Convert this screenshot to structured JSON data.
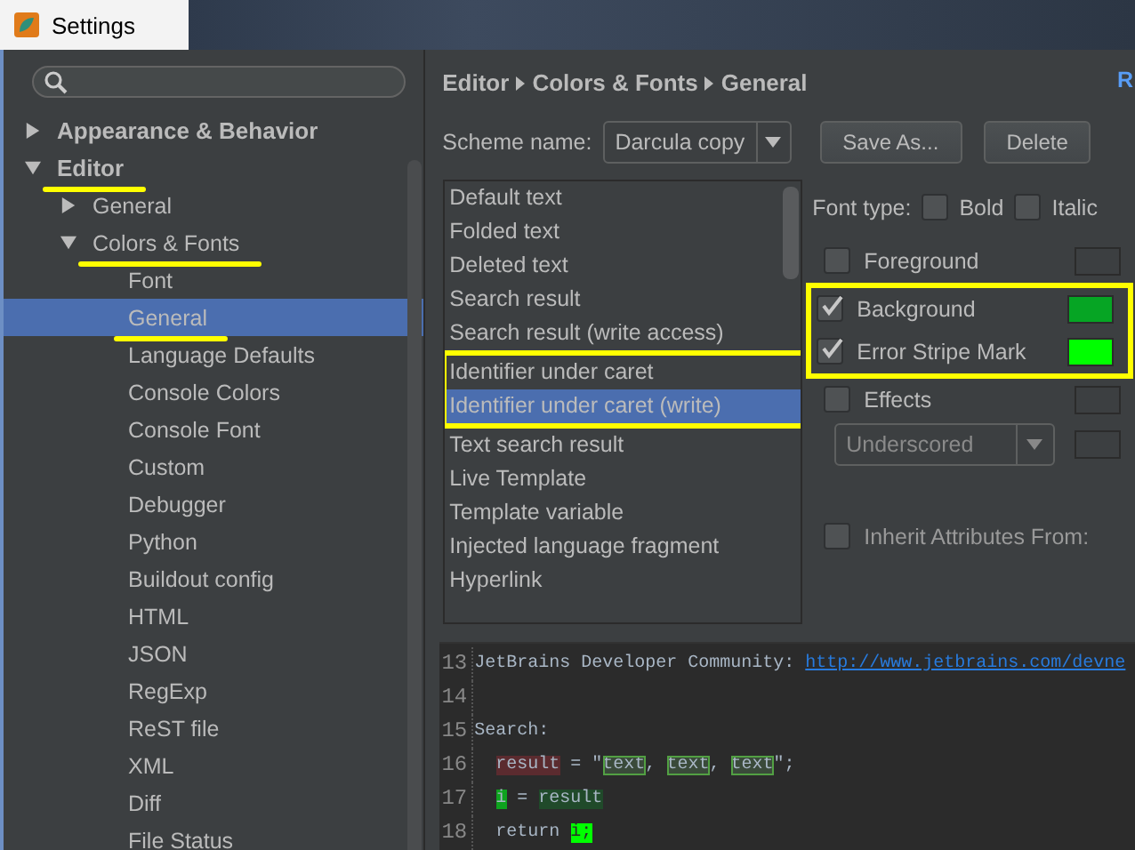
{
  "window": {
    "title": "Settings"
  },
  "sidebar": {
    "tree": [
      {
        "label": "Appearance & Behavior",
        "bold": true,
        "expanded": false,
        "underlined": false,
        "selected": false
      },
      {
        "label": "Editor",
        "bold": true,
        "expanded": true,
        "underlined": true,
        "selected": false,
        "children": [
          {
            "label": "General",
            "expanded": false,
            "underlined": false,
            "selected": false
          },
          {
            "label": "Colors & Fonts",
            "expanded": true,
            "underlined": true,
            "selected": false,
            "children": [
              {
                "label": "Font",
                "underlined": false,
                "selected": false
              },
              {
                "label": "General",
                "underlined": true,
                "selected": true
              },
              {
                "label": "Language Defaults",
                "underlined": false,
                "selected": false
              },
              {
                "label": "Console Colors",
                "underlined": false,
                "selected": false
              },
              {
                "label": "Console Font",
                "underlined": false,
                "selected": false
              },
              {
                "label": "Custom",
                "underlined": false,
                "selected": false
              },
              {
                "label": "Debugger",
                "underlined": false,
                "selected": false
              },
              {
                "label": "Python",
                "underlined": false,
                "selected": false
              },
              {
                "label": "Buildout config",
                "underlined": false,
                "selected": false
              },
              {
                "label": "HTML",
                "underlined": false,
                "selected": false
              },
              {
                "label": "JSON",
                "underlined": false,
                "selected": false
              },
              {
                "label": "RegExp",
                "underlined": false,
                "selected": false
              },
              {
                "label": "ReST file",
                "underlined": false,
                "selected": false
              },
              {
                "label": "XML",
                "underlined": false,
                "selected": false
              },
              {
                "label": "Diff",
                "underlined": false,
                "selected": false
              },
              {
                "label": "File Status",
                "underlined": false,
                "selected": false
              }
            ]
          }
        ]
      }
    ]
  },
  "breadcrumb": [
    "Editor",
    "Colors & Fonts",
    "General"
  ],
  "reset_link": "R",
  "scheme": {
    "label": "Scheme name:",
    "value": "Darcula copy",
    "buttons": [
      "Save As...",
      "Delete"
    ]
  },
  "attributes": [
    {
      "label": "Default text",
      "selected": false,
      "boxed": false
    },
    {
      "label": "Folded text",
      "selected": false,
      "boxed": false
    },
    {
      "label": "Deleted text",
      "selected": false,
      "boxed": false
    },
    {
      "label": "Search result",
      "selected": false,
      "boxed": false
    },
    {
      "label": "Search result (write access)",
      "selected": false,
      "boxed": false
    },
    {
      "label": "Identifier under caret",
      "selected": false,
      "boxed": true
    },
    {
      "label": "Identifier under caret (write)",
      "selected": true,
      "boxed": true
    },
    {
      "label": "Text search result",
      "selected": false,
      "boxed": false
    },
    {
      "label": "Live Template",
      "selected": false,
      "boxed": false
    },
    {
      "label": "Template variable",
      "selected": false,
      "boxed": false
    },
    {
      "label": "Injected language fragment",
      "selected": false,
      "boxed": false
    },
    {
      "label": "Hyperlink",
      "selected": false,
      "boxed": false
    }
  ],
  "font_type": {
    "label": "Font type:",
    "options": [
      {
        "label": "Bold",
        "checked": false
      },
      {
        "label": "Italic",
        "checked": false
      }
    ]
  },
  "color_options": [
    {
      "label": "Foreground",
      "checked": false,
      "boxed": false
    },
    {
      "label": "Background",
      "checked": true,
      "boxed": true,
      "color": "#06a524"
    },
    {
      "label": "Error Stripe Mark",
      "checked": true,
      "boxed": true,
      "color": "#00ff00"
    },
    {
      "label": "Effects",
      "checked": false,
      "boxed": false
    }
  ],
  "effect_type": {
    "value": "Underscored",
    "disabled": true
  },
  "inherit": {
    "label": "Inherit Attributes From:",
    "checked": false
  },
  "preview": {
    "lines": [
      {
        "number": "13",
        "segments": [
          {
            "kind": "plain",
            "text": "JetBrains Developer Community: "
          },
          {
            "kind": "link",
            "text": "http://www.jetbrains.com/devne"
          }
        ]
      },
      {
        "number": "14"
      },
      {
        "number": "15",
        "segments": [
          {
            "kind": "plain",
            "text": "Search:"
          }
        ]
      },
      {
        "number": "16",
        "indented": true,
        "segments": [
          {
            "kind": "read",
            "text": "result"
          },
          {
            "kind": "plain",
            "text": " = \""
          },
          {
            "kind": "match",
            "text": "text"
          },
          {
            "kind": "plain",
            "text": ", "
          },
          {
            "kind": "match",
            "text": "text"
          },
          {
            "kind": "plain",
            "text": ", "
          },
          {
            "kind": "match",
            "text": "text"
          },
          {
            "kind": "plain",
            "text": "\";"
          }
        ]
      },
      {
        "number": "17",
        "indented": true,
        "segments": [
          {
            "kind": "write",
            "text": "i"
          },
          {
            "kind": "plain",
            "text": " = "
          },
          {
            "kind": "usage",
            "text": "result"
          }
        ]
      },
      {
        "number": "18",
        "indented": true,
        "segments": [
          {
            "kind": "plain",
            "text": "return "
          },
          {
            "kind": "stripe",
            "text": "i;"
          }
        ]
      }
    ]
  }
}
